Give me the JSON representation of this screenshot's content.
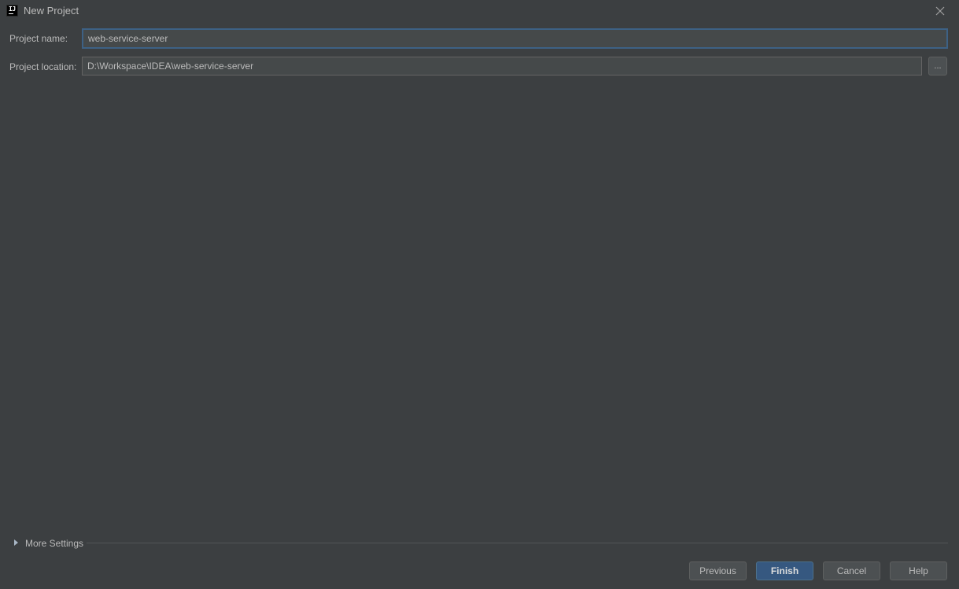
{
  "window": {
    "title": "New Project",
    "icon_text": "IJ",
    "icon": "intellij-idea-icon",
    "close_icon": "close-icon"
  },
  "form": {
    "project_name_label": "Project name:",
    "project_name_value": "web-service-server",
    "project_location_label": "Project location:",
    "project_location_value": "D:\\Workspace\\IDEA\\web-service-server",
    "browse_button_label": "..."
  },
  "more_settings": {
    "label": "More Settings",
    "expanded": false,
    "icon": "triangle-right-icon"
  },
  "buttons": {
    "previous": "Previous",
    "finish": "Finish",
    "cancel": "Cancel",
    "help": "Help"
  },
  "colors": {
    "background": "#3c3f41",
    "focus_border": "#3d6185",
    "primary_button": "#365880"
  }
}
